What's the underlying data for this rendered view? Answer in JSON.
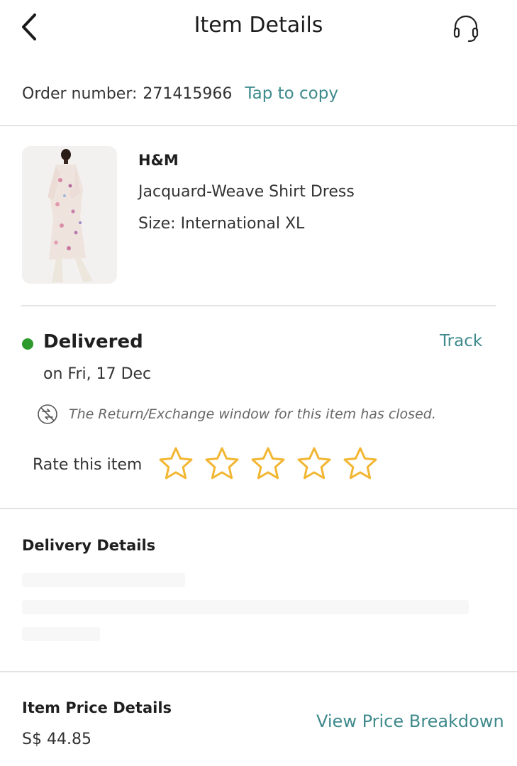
{
  "header": {
    "title": "Item Details",
    "back_icon": "chevron-left-icon",
    "support_icon": "headset-icon"
  },
  "order": {
    "label": "Order number:",
    "number": "271415966",
    "copy_label": "Tap to copy"
  },
  "product": {
    "brand": "H&M",
    "name": "Jacquard-Weave Shirt Dress",
    "size": "Size: International XL"
  },
  "status": {
    "label": "Delivered",
    "date": "on Fri, 17 Dec",
    "track_label": "Track",
    "return_notice": "The Return/Exchange window for this item has closed.",
    "dot_color": "#2e9a2e"
  },
  "rating": {
    "label": "Rate this item",
    "max_stars": 5,
    "selected": 0,
    "star_color": "#f2b632"
  },
  "delivery": {
    "heading": "Delivery Details"
  },
  "price": {
    "heading": "Item Price Details",
    "value": "S$ 44.85",
    "breakdown_label": "View Price Breakdown"
  },
  "colors": {
    "accent": "#3f8a8c",
    "divider": "#e3e3e3"
  }
}
